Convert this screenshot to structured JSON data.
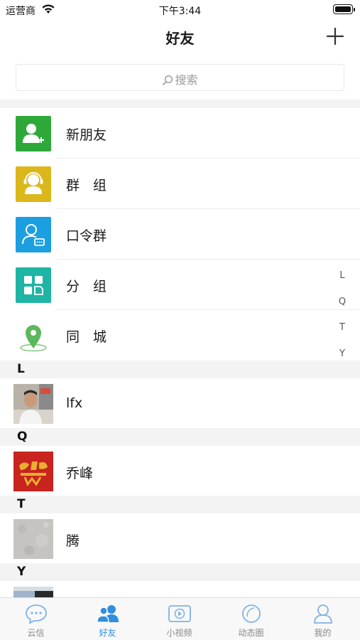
{
  "status_bar": {
    "carrier": "运营商",
    "time": "下午3:44"
  },
  "nav": {
    "title": "好友"
  },
  "search": {
    "placeholder": "搜索"
  },
  "menu": [
    {
      "label": "新朋友",
      "icon": "add-friend-icon",
      "color": "#2fa83a"
    },
    {
      "label": "群　组",
      "icon": "group-icon",
      "color": "#dbb71b"
    },
    {
      "label": "口令群",
      "icon": "password-group-icon",
      "color": "#1c9fe0"
    },
    {
      "label": "分　组",
      "icon": "category-icon",
      "color": "#1fb5a5"
    },
    {
      "label": "同　城",
      "icon": "location-pin-icon",
      "color": "#5cb85c"
    }
  ],
  "sections": [
    {
      "letter": "L",
      "contacts": [
        {
          "name": "lfx"
        }
      ]
    },
    {
      "letter": "Q",
      "contacts": [
        {
          "name": "乔峰"
        }
      ]
    },
    {
      "letter": "T",
      "contacts": [
        {
          "name": "腾"
        }
      ]
    },
    {
      "letter": "Y",
      "contacts": [
        {
          "name": ""
        }
      ]
    }
  ],
  "index": [
    "L",
    "Q",
    "T",
    "Y"
  ],
  "tabs": [
    {
      "label": "云信",
      "icon": "chat-bubble-icon",
      "active": false
    },
    {
      "label": "好友",
      "icon": "friends-icon",
      "active": true
    },
    {
      "label": "小视频",
      "icon": "video-icon",
      "active": false
    },
    {
      "label": "动态圈",
      "icon": "moments-icon",
      "active": false
    },
    {
      "label": "我的",
      "icon": "profile-icon",
      "active": false
    }
  ],
  "colors": {
    "accent": "#2f8fe0",
    "inactive": "#7fb3e6",
    "section_bg": "#f3f3f3"
  }
}
